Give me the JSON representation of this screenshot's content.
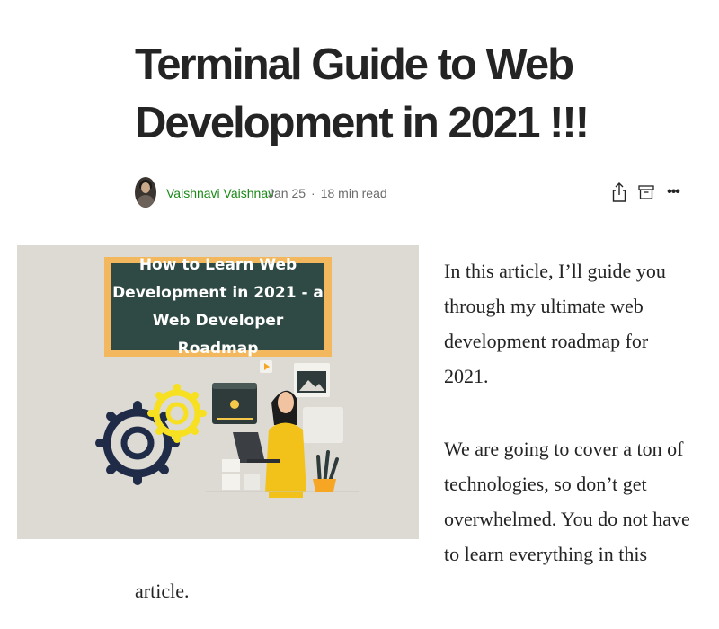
{
  "article": {
    "title": "Terminal Guide to Web Development in 2021 !!!",
    "author": "Vaishnavi Vaishnav",
    "date": "Jan 25",
    "separator": "·",
    "read_time": "18 min read",
    "hero_heading": "How to Learn Web Development in 2021 - a Web Developer Roadmap",
    "paragraph1": "In this article, I’ll guide you through my ultimate web development roadmap for 2021.",
    "paragraph2_main": "We are going to cover a ton of technologies, so don’t get overwhelmed. You do not have to learn everything in this",
    "paragraph2_tail": "article."
  },
  "actions": {
    "share_icon": "share-icon",
    "save_icon": "bookmark-save-icon",
    "more_label": "•••"
  },
  "colors": {
    "author_link": "#1a8917",
    "hero_background": "#dcdad3",
    "board_frame": "#f3b75e",
    "board_fill": "#2f4a44",
    "text": "#242424"
  }
}
